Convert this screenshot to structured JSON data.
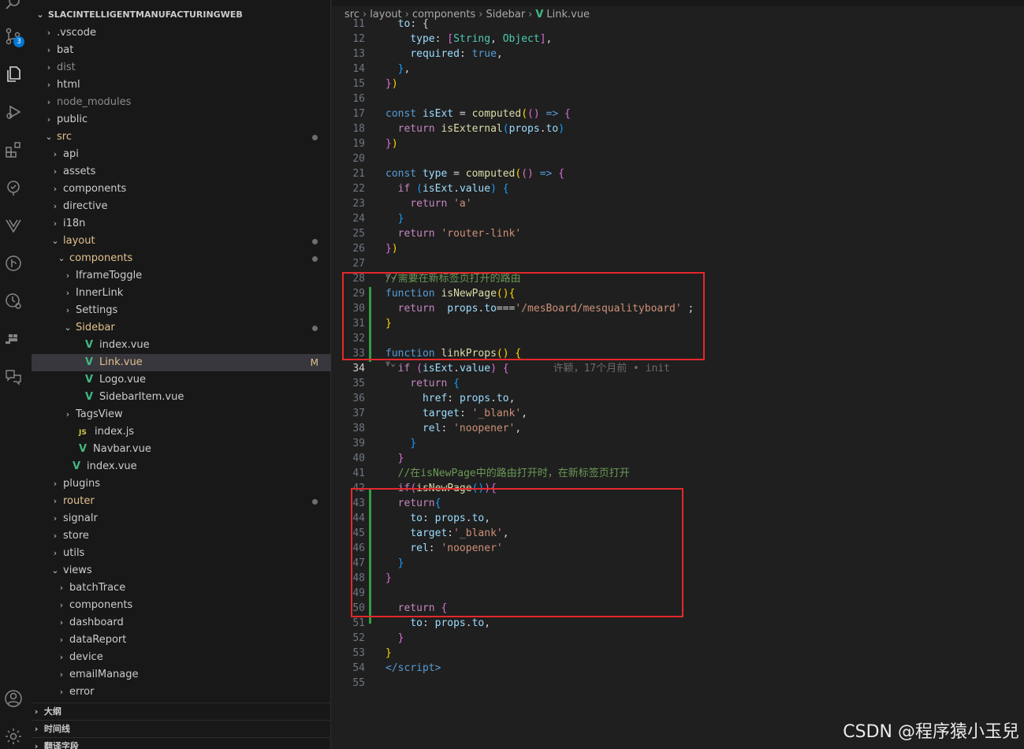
{
  "activity_bar": {
    "source_control_badge": "3"
  },
  "explorer": {
    "root": "SLACINTELLIGENTMANUFACTURINGWEB",
    "items": [
      {
        "label": ".vscode",
        "depth": 1,
        "type": "folder",
        "open": false
      },
      {
        "label": "bat",
        "depth": 1,
        "type": "folder",
        "open": false
      },
      {
        "label": "dist",
        "depth": 1,
        "type": "folder",
        "open": false,
        "dim": true
      },
      {
        "label": "html",
        "depth": 1,
        "type": "folder",
        "open": false
      },
      {
        "label": "node_modules",
        "depth": 1,
        "type": "folder",
        "open": false,
        "dim": true
      },
      {
        "label": "public",
        "depth": 1,
        "type": "folder",
        "open": false
      },
      {
        "label": "src",
        "depth": 1,
        "type": "folder",
        "open": true,
        "modified": true,
        "dot": true
      },
      {
        "label": "api",
        "depth": 2,
        "type": "folder",
        "open": false
      },
      {
        "label": "assets",
        "depth": 2,
        "type": "folder",
        "open": false
      },
      {
        "label": "components",
        "depth": 2,
        "type": "folder",
        "open": false
      },
      {
        "label": "directive",
        "depth": 2,
        "type": "folder",
        "open": false
      },
      {
        "label": "i18n",
        "depth": 2,
        "type": "folder",
        "open": false
      },
      {
        "label": "layout",
        "depth": 2,
        "type": "folder",
        "open": true,
        "modified": true,
        "dot": true
      },
      {
        "label": "components",
        "depth": 3,
        "type": "folder",
        "open": true,
        "modified": true,
        "dot": true
      },
      {
        "label": "IframeToggle",
        "depth": 4,
        "type": "folder",
        "open": false
      },
      {
        "label": "InnerLink",
        "depth": 4,
        "type": "folder",
        "open": false
      },
      {
        "label": "Settings",
        "depth": 4,
        "type": "folder",
        "open": false
      },
      {
        "label": "Sidebar",
        "depth": 4,
        "type": "folder",
        "open": true,
        "modified": true,
        "dot": true
      },
      {
        "label": "index.vue",
        "depth": 5,
        "type": "vue"
      },
      {
        "label": "Link.vue",
        "depth": 5,
        "type": "vue",
        "selected": true,
        "modified": true,
        "badge": "M"
      },
      {
        "label": "Logo.vue",
        "depth": 5,
        "type": "vue"
      },
      {
        "label": "SidebarItem.vue",
        "depth": 5,
        "type": "vue"
      },
      {
        "label": "TagsView",
        "depth": 4,
        "type": "folder",
        "open": false
      },
      {
        "label": "index.js",
        "depth": 4,
        "type": "js"
      },
      {
        "label": "Navbar.vue",
        "depth": 4,
        "type": "vue"
      },
      {
        "label": "index.vue",
        "depth": 3,
        "type": "vue"
      },
      {
        "label": "plugins",
        "depth": 2,
        "type": "folder",
        "open": false
      },
      {
        "label": "router",
        "depth": 2,
        "type": "folder",
        "open": false,
        "modified": true,
        "dot": true
      },
      {
        "label": "signalr",
        "depth": 2,
        "type": "folder",
        "open": false
      },
      {
        "label": "store",
        "depth": 2,
        "type": "folder",
        "open": false
      },
      {
        "label": "utils",
        "depth": 2,
        "type": "folder",
        "open": false
      },
      {
        "label": "views",
        "depth": 2,
        "type": "folder",
        "open": true
      },
      {
        "label": "batchTrace",
        "depth": 3,
        "type": "folder",
        "open": false
      },
      {
        "label": "components",
        "depth": 3,
        "type": "folder",
        "open": false
      },
      {
        "label": "dashboard",
        "depth": 3,
        "type": "folder",
        "open": false
      },
      {
        "label": "dataReport",
        "depth": 3,
        "type": "folder",
        "open": false
      },
      {
        "label": "device",
        "depth": 3,
        "type": "folder",
        "open": false
      },
      {
        "label": "emailManage",
        "depth": 3,
        "type": "folder",
        "open": false
      },
      {
        "label": "error",
        "depth": 3,
        "type": "folder",
        "open": false
      }
    ],
    "panels": [
      "大纲",
      "时间线",
      "翻译字段"
    ]
  },
  "breadcrumb": [
    "src",
    "layout",
    "components",
    "Sidebar",
    "Link.vue"
  ],
  "editor": {
    "active_line": "34",
    "blame": "许颖，17个月前 • init",
    "lines": [
      {
        "n": "12",
        "tokens": [
          [
            "pl",
            "    "
          ],
          [
            "var",
            "type"
          ],
          [
            "pl",
            ": "
          ],
          [
            "br2",
            "["
          ],
          [
            "typ",
            "String"
          ],
          [
            "pl",
            ", "
          ],
          [
            "typ",
            "Object"
          ],
          [
            "br2",
            "]"
          ],
          [
            "pl",
            ","
          ]
        ]
      },
      {
        "n": "13",
        "tokens": [
          [
            "pl",
            "    "
          ],
          [
            "var",
            "required"
          ],
          [
            "pl",
            ": "
          ],
          [
            "kw",
            "true"
          ],
          [
            "pl",
            ","
          ]
        ]
      },
      {
        "n": "14",
        "tokens": [
          [
            "pl",
            "  "
          ],
          [
            "br3",
            "}"
          ],
          [
            "pl",
            ","
          ]
        ]
      },
      {
        "n": "15",
        "tokens": [
          [
            "br2",
            "}"
          ],
          [
            "br1",
            ")"
          ]
        ]
      },
      {
        "n": "16",
        "tokens": []
      },
      {
        "n": "17",
        "tokens": [
          [
            "kw",
            "const "
          ],
          [
            "var",
            "isExt"
          ],
          [
            "pl",
            " = "
          ],
          [
            "fn",
            "computed"
          ],
          [
            "br1",
            "("
          ],
          [
            "br2",
            "()"
          ],
          [
            "kw",
            " => "
          ],
          [
            "br2",
            "{"
          ]
        ]
      },
      {
        "n": "18",
        "tokens": [
          [
            "pl",
            "  "
          ],
          [
            "kw2",
            "return "
          ],
          [
            "fn",
            "isExternal"
          ],
          [
            "br3",
            "("
          ],
          [
            "var",
            "props"
          ],
          [
            "pl",
            "."
          ],
          [
            "var",
            "to"
          ],
          [
            "br3",
            ")"
          ]
        ]
      },
      {
        "n": "19",
        "tokens": [
          [
            "br2",
            "}"
          ],
          [
            "br1",
            ")"
          ]
        ]
      },
      {
        "n": "20",
        "tokens": []
      },
      {
        "n": "21",
        "tokens": [
          [
            "kw",
            "const "
          ],
          [
            "var",
            "type"
          ],
          [
            "pl",
            " = "
          ],
          [
            "fn",
            "computed"
          ],
          [
            "br1",
            "("
          ],
          [
            "br2",
            "()"
          ],
          [
            "kw",
            " => "
          ],
          [
            "br2",
            "{"
          ]
        ]
      },
      {
        "n": "22",
        "tokens": [
          [
            "pl",
            "  "
          ],
          [
            "kw2",
            "if "
          ],
          [
            "br3",
            "("
          ],
          [
            "var",
            "isExt"
          ],
          [
            "pl",
            "."
          ],
          [
            "var",
            "value"
          ],
          [
            "br3",
            ")"
          ],
          [
            "pl",
            " "
          ],
          [
            "br3",
            "{"
          ]
        ]
      },
      {
        "n": "23",
        "tokens": [
          [
            "pl",
            "    "
          ],
          [
            "kw2",
            "return "
          ],
          [
            "str",
            "'a'"
          ]
        ]
      },
      {
        "n": "24",
        "tokens": [
          [
            "pl",
            "  "
          ],
          [
            "br3",
            "}"
          ]
        ]
      },
      {
        "n": "25",
        "tokens": [
          [
            "pl",
            "  "
          ],
          [
            "kw2",
            "return "
          ],
          [
            "str",
            "'router-link'"
          ]
        ]
      },
      {
        "n": "26",
        "tokens": [
          [
            "br2",
            "}"
          ],
          [
            "br1",
            ")"
          ]
        ]
      },
      {
        "n": "27",
        "tokens": []
      },
      {
        "n": "28",
        "tokens": [
          [
            "cm",
            "//需要在新标签页打开的路由"
          ]
        ]
      },
      {
        "n": "29",
        "tokens": [
          [
            "kw",
            "function "
          ],
          [
            "fn",
            "isNewPage"
          ],
          [
            "br1",
            "()"
          ],
          [
            "br1",
            "{"
          ]
        ]
      },
      {
        "n": "30",
        "tokens": [
          [
            "pl",
            "  "
          ],
          [
            "kw2",
            "return  "
          ],
          [
            "var",
            "props"
          ],
          [
            "pl",
            "."
          ],
          [
            "var",
            "to"
          ],
          [
            "pl",
            "==="
          ],
          [
            "str",
            "'/mesBoard/mesqualityboard'"
          ],
          [
            "pl",
            " ;"
          ]
        ]
      },
      {
        "n": "31",
        "tokens": [
          [
            "br1",
            "}"
          ]
        ]
      },
      {
        "n": "32",
        "tokens": []
      },
      {
        "n": "33",
        "tokens": [
          [
            "kw",
            "function "
          ],
          [
            "fn",
            "linkProps"
          ],
          [
            "br1",
            "()"
          ],
          [
            "pl",
            " "
          ],
          [
            "br1",
            "{"
          ]
        ]
      },
      {
        "n": "34",
        "tokens": [
          [
            "pl",
            "  "
          ],
          [
            "kw2",
            "if "
          ],
          [
            "br2",
            "("
          ],
          [
            "var",
            "isExt"
          ],
          [
            "pl",
            "."
          ],
          [
            "var",
            "value"
          ],
          [
            "br2",
            ")"
          ],
          [
            "pl",
            " "
          ],
          [
            "br2",
            "{"
          ]
        ]
      },
      {
        "n": "35",
        "tokens": [
          [
            "pl",
            "    "
          ],
          [
            "kw2",
            "return "
          ],
          [
            "br3",
            "{"
          ]
        ]
      },
      {
        "n": "36",
        "tokens": [
          [
            "pl",
            "      "
          ],
          [
            "var",
            "href"
          ],
          [
            "pl",
            ": "
          ],
          [
            "var",
            "props"
          ],
          [
            "pl",
            "."
          ],
          [
            "var",
            "to"
          ],
          [
            "pl",
            ","
          ]
        ]
      },
      {
        "n": "37",
        "tokens": [
          [
            "pl",
            "      "
          ],
          [
            "var",
            "target"
          ],
          [
            "pl",
            ": "
          ],
          [
            "str",
            "'_blank'"
          ],
          [
            "pl",
            ","
          ]
        ]
      },
      {
        "n": "38",
        "tokens": [
          [
            "pl",
            "      "
          ],
          [
            "var",
            "rel"
          ],
          [
            "pl",
            ": "
          ],
          [
            "str",
            "'noopener'"
          ],
          [
            "pl",
            ","
          ]
        ]
      },
      {
        "n": "39",
        "tokens": [
          [
            "pl",
            "    "
          ],
          [
            "br3",
            "}"
          ]
        ]
      },
      {
        "n": "40",
        "tokens": [
          [
            "pl",
            "  "
          ],
          [
            "br2",
            "}"
          ]
        ]
      },
      {
        "n": "41",
        "tokens": [
          [
            "pl",
            "  "
          ],
          [
            "cm",
            "//在isNewPage中的路由打开时，在新标签页打开"
          ]
        ]
      },
      {
        "n": "42",
        "tokens": [
          [
            "pl",
            "  "
          ],
          [
            "kw2",
            "if"
          ],
          [
            "br2",
            "("
          ],
          [
            "fn",
            "isNewPage"
          ],
          [
            "br3",
            "()"
          ],
          [
            "br2",
            ")"
          ],
          [
            "br2",
            "{"
          ]
        ]
      },
      {
        "n": "43",
        "tokens": [
          [
            "pl",
            "  "
          ],
          [
            "kw2",
            "return"
          ],
          [
            "br3",
            "{"
          ]
        ]
      },
      {
        "n": "44",
        "tokens": [
          [
            "pl",
            "    "
          ],
          [
            "var",
            "to"
          ],
          [
            "pl",
            ": "
          ],
          [
            "var",
            "props"
          ],
          [
            "pl",
            "."
          ],
          [
            "var",
            "to"
          ],
          [
            "pl",
            ","
          ]
        ]
      },
      {
        "n": "45",
        "tokens": [
          [
            "pl",
            "    "
          ],
          [
            "var",
            "target"
          ],
          [
            "pl",
            ":"
          ],
          [
            "str",
            "'_blank'"
          ],
          [
            "pl",
            ","
          ]
        ]
      },
      {
        "n": "46",
        "tokens": [
          [
            "pl",
            "    "
          ],
          [
            "var",
            "rel"
          ],
          [
            "pl",
            ": "
          ],
          [
            "str",
            "'noopener'"
          ]
        ]
      },
      {
        "n": "47",
        "tokens": [
          [
            "pl",
            "  "
          ],
          [
            "br3",
            "}"
          ]
        ]
      },
      {
        "n": "48",
        "tokens": [
          [
            "br2",
            "}"
          ]
        ]
      },
      {
        "n": "49",
        "tokens": []
      },
      {
        "n": "50",
        "tokens": [
          [
            "pl",
            "  "
          ],
          [
            "kw2",
            "return "
          ],
          [
            "br2",
            "{"
          ]
        ]
      },
      {
        "n": "51",
        "tokens": [
          [
            "pl",
            "    "
          ],
          [
            "var",
            "to"
          ],
          [
            "pl",
            ": "
          ],
          [
            "var",
            "props"
          ],
          [
            "pl",
            "."
          ],
          [
            "var",
            "to"
          ],
          [
            "pl",
            ","
          ]
        ]
      },
      {
        "n": "52",
        "tokens": [
          [
            "pl",
            "  "
          ],
          [
            "br2",
            "}"
          ]
        ]
      },
      {
        "n": "53",
        "tokens": [
          [
            "br1",
            "}"
          ]
        ]
      },
      {
        "n": "54",
        "tokens": [
          [
            "kw",
            "</"
          ],
          [
            "kw",
            "script"
          ],
          [
            "kw",
            ">"
          ]
        ]
      },
      {
        "n": "55",
        "tokens": []
      }
    ]
  },
  "watermark": "CSDN @程序猿小玉兒"
}
